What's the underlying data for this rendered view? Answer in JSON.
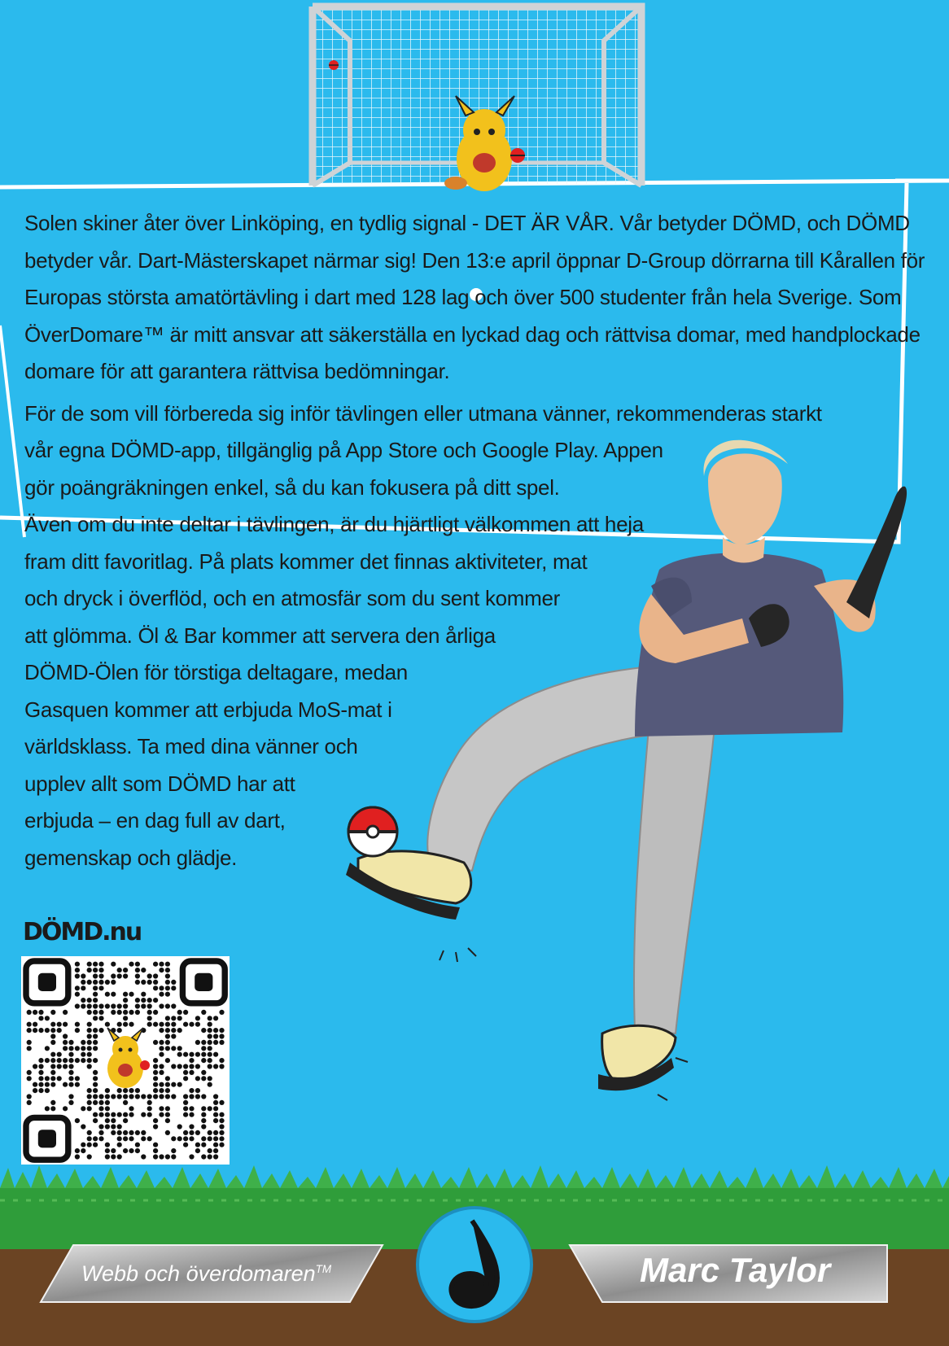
{
  "article": {
    "paragraph1": "Solen skiner åter över Linköping, en tydlig signal - DET ÄR VÅR. Vår betyder DÖMD,  och DÖMD betyder vår.  Dart-Mästerskapet närmar sig! Den 13:e april öppnar D-Group dörrarna till Kårallen för Europas största amatörtävling i dart med 128 lag och över 500 studenter från hela Sverige.  Som ÖverDomare™ är mitt ansvar att säkerställa en lyckad dag och rättvisa domar, med handplockade domare för att garantera rättvisa bedömningar.",
    "paragraph2_lines": [
      "För de som vill förbereda sig inför tävlingen eller utmana vänner,  rekommenderas starkt",
      "vår egna DÖMD-app,  tillgänglig på App Store och Google Play. Appen",
      "gör poängräkningen enkel, så du kan fokusera på ditt spel.",
      "Även om du inte deltar i tävlingen, är du hjärtligt välkommen att heja",
      "fram ditt favoritlag. På plats kommer det finnas aktiviteter, mat",
      "och dryck i överflöd, och en atmosfär som du sent kommer",
      "att glömma. Öl & Bar kommer att servera den årliga",
      "DÖMD-Ölen för törstiga deltagare, medan",
      "Gasquen kommer att erbjuda MoS-mat i",
      "världsklass.  Ta med dina vänner och",
      "upplev allt som DÖMD har att",
      "erbjuda – en dag full av dart,",
      "gemenskap och glädje."
    ]
  },
  "site_logo": "DÖMD.nu",
  "footer": {
    "left_label": "Webb och överdomaren",
    "left_sup": "TM",
    "right_label": "Marc Taylor"
  },
  "colors": {
    "sky": "#2bbaed",
    "grass": "#2f9d3a",
    "soil": "#6b4423",
    "shirt": "#55597a",
    "pants": "#bfbfbf"
  },
  "icons": [
    "goal-net",
    "cat-mascot-icon",
    "pokeball-icon",
    "player-illustration",
    "qr-code",
    "logo-badge-icon"
  ]
}
